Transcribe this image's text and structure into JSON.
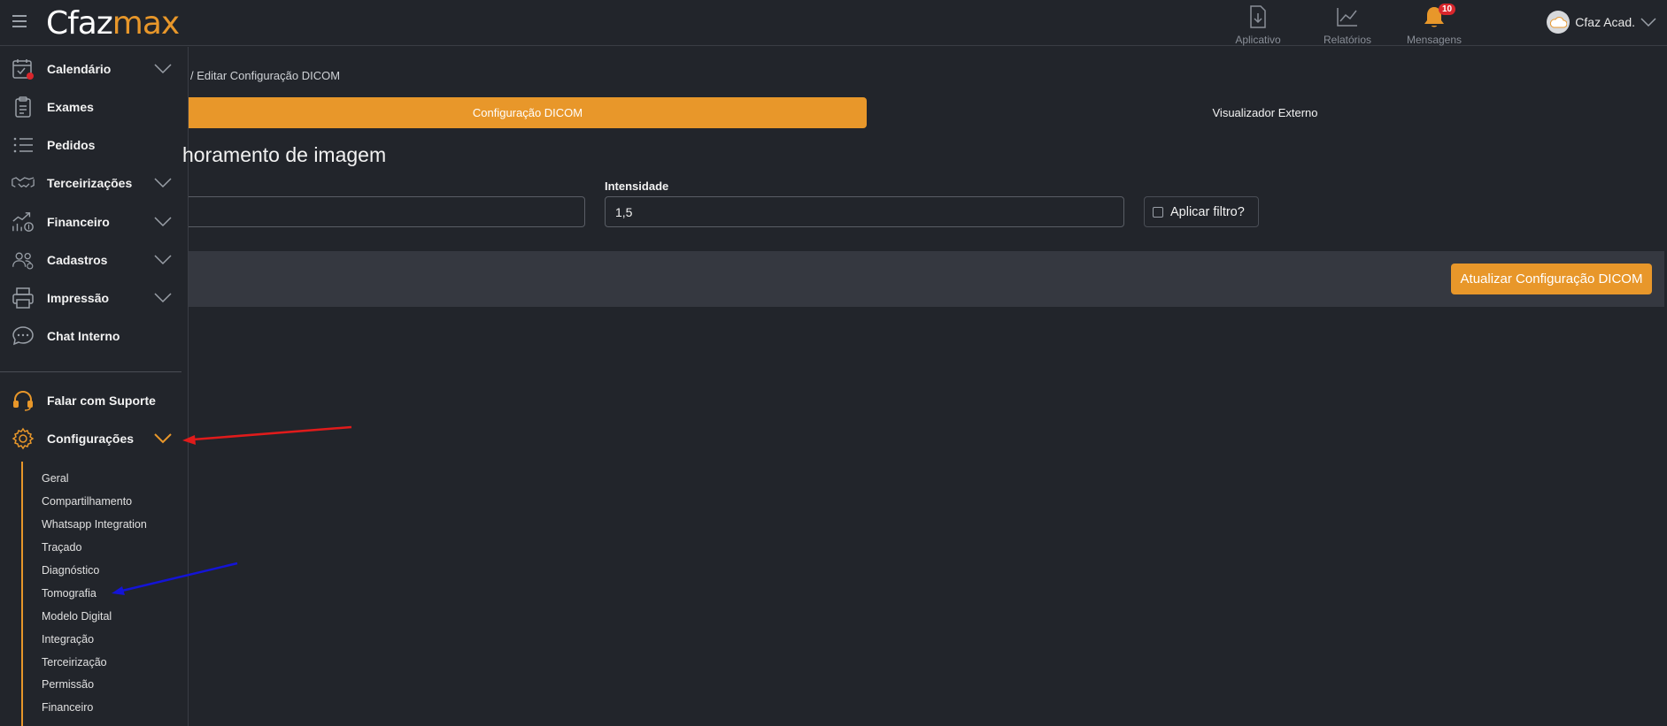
{
  "app": {
    "logo_part1": "Cfaz",
    "logo_part2": "max"
  },
  "topnav": [
    {
      "label": "Aplicativo",
      "icon": "download-icon"
    },
    {
      "label": "Relatórios",
      "icon": "chart-icon"
    },
    {
      "label": "Mensagens",
      "icon": "bell-icon",
      "badge": "10"
    }
  ],
  "user": {
    "name": "Cfaz Acad."
  },
  "sidebar": {
    "items": [
      {
        "label": "Calendário",
        "icon": "calendar-icon",
        "expandable": true
      },
      {
        "label": "Exames",
        "icon": "clipboard-icon",
        "expandable": false
      },
      {
        "label": "Pedidos",
        "icon": "list-icon",
        "expandable": false
      },
      {
        "label": "Terceirizações",
        "icon": "handshake-icon",
        "expandable": true
      },
      {
        "label": "Financeiro",
        "icon": "finance-icon",
        "expandable": true
      },
      {
        "label": "Cadastros",
        "icon": "users-icon",
        "expandable": true
      },
      {
        "label": "Impressão",
        "icon": "printer-icon",
        "expandable": true
      },
      {
        "label": "Chat Interno",
        "icon": "chat-icon",
        "expandable": false
      },
      {
        "label": "Falar com Suporte",
        "icon": "headset-icon",
        "expandable": false
      },
      {
        "label": "Configurações",
        "icon": "gear-icon",
        "expandable": true,
        "expanded": true
      }
    ],
    "submenu": [
      "Geral",
      "Compartilhamento",
      "Whatsapp Integration",
      "Traçado",
      "Diagnóstico",
      "Tomografia",
      "Modelo Digital",
      "Integração",
      "Terceirização",
      "Permissão",
      "Financeiro"
    ]
  },
  "main": {
    "breadcrumb": "/  Editar Configuração DICOM",
    "tabs": [
      {
        "label": "Configuração DICOM",
        "active": true
      },
      {
        "label": "Visualizador Externo",
        "active": false
      }
    ],
    "section_title": "horamento de imagem",
    "intensity_label": "Intensidade",
    "intensity_value": "1,5",
    "filter_label": "Aplicar filtro?",
    "filter_checked": false,
    "update_button": "Atualizar Configuração DICOM"
  },
  "colors": {
    "accent": "#e8972a",
    "background": "#22252b",
    "panel": "#353840"
  }
}
